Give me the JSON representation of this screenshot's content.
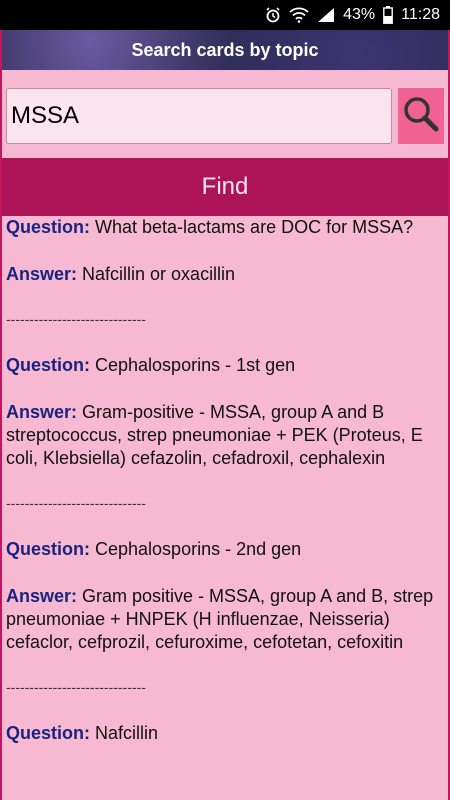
{
  "status": {
    "battery": "43%",
    "time": "11:28"
  },
  "header": {
    "title": "Search cards by topic"
  },
  "search": {
    "value": "MSSA"
  },
  "find_label": "Find",
  "labels": {
    "question": "Question:",
    "answer": "Answer:"
  },
  "separator": "------------------------------",
  "cards": [
    {
      "question": " What beta-lactams are DOC for MSSA?",
      "answer": " Nafcillin or oxacillin"
    },
    {
      "question": " Cephalosporins - 1st gen",
      "answer": " Gram-positive - MSSA, group A and B streptococcus, strep pneumoniae + PEK (Proteus, E coli, Klebsiella) cefazolin, cefadroxil, cephalexin"
    },
    {
      "question": " Cephalosporins - 2nd gen",
      "answer": " Gram positive - MSSA, group A and B, strep pneumoniae + HNPEK (H influenzae, Neisseria) cefaclor, cefprozil, cefuroxime, cefotetan, cefoxitin"
    },
    {
      "question": " Nafcillin",
      "answer": ""
    }
  ]
}
